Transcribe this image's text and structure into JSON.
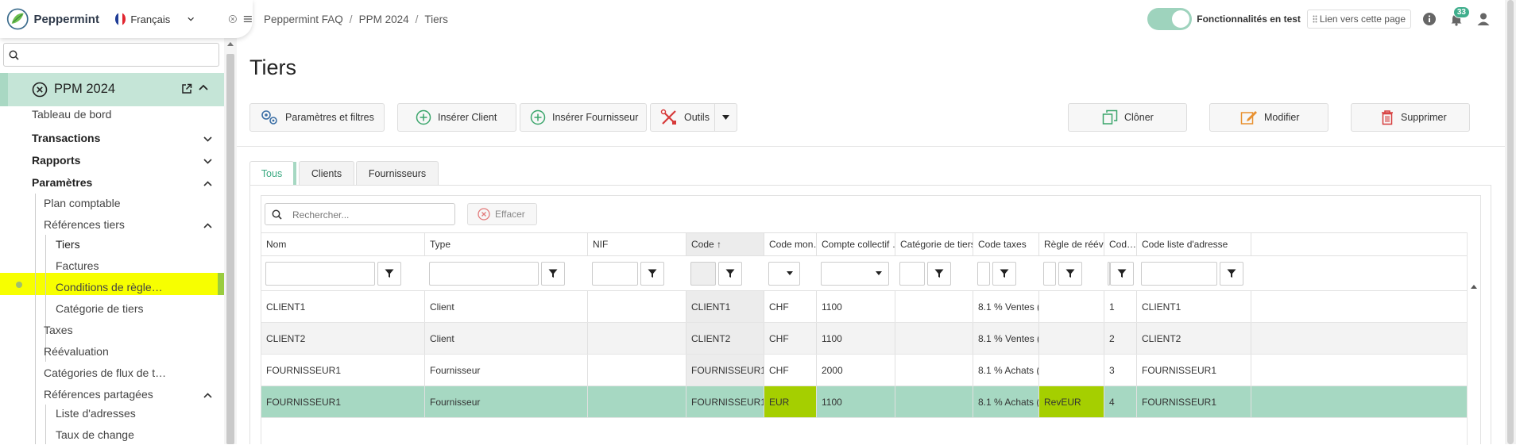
{
  "brand": {
    "app_name": "Peppermint",
    "language": "Français"
  },
  "breadcrumb": [
    "Peppermint FAQ",
    "PPM 2024",
    "Tiers"
  ],
  "header": {
    "toggle_label": "Fonctionnalités en test",
    "link_label": "Lien vers cette page",
    "notification_count": "33"
  },
  "sidebar": {
    "search_value": "",
    "project": "PPM 2024",
    "items": [
      {
        "label": "Tableau de bord"
      },
      {
        "label": "Transactions"
      },
      {
        "label": "Rapports"
      },
      {
        "label": "Paramètres"
      },
      {
        "label": "Plan comptable"
      },
      {
        "label": "Références tiers"
      },
      {
        "label": "Tiers"
      },
      {
        "label": "Factures"
      },
      {
        "label": "Conditions de règle…"
      },
      {
        "label": "Catégorie de tiers"
      },
      {
        "label": "Taxes"
      },
      {
        "label": "Réévaluation"
      },
      {
        "label": "Catégories de flux de t…"
      },
      {
        "label": "Références partagées"
      },
      {
        "label": "Liste d'adresses"
      },
      {
        "label": "Taux de change"
      }
    ]
  },
  "page": {
    "title": "Tiers"
  },
  "toolbar": {
    "params": "Paramètres et filtres",
    "insert_client": "Insérer Client",
    "insert_supplier": "Insérer Fournisseur",
    "tools": "Outils",
    "clone": "Clôner",
    "edit": "Modifier",
    "delete": "Supprimer"
  },
  "tabs": [
    "Tous",
    "Clients",
    "Fournisseurs"
  ],
  "grid": {
    "search_placeholder": "Rechercher...",
    "clear_label": "Effacer",
    "columns": [
      "Nom",
      "Type",
      "NIF",
      "Code",
      "Code mon…",
      "Compte collectif …",
      "Catégorie de tiers",
      "Code taxes",
      "Règle de réév…",
      "Cod…",
      "Code liste d'adresse"
    ],
    "sort_indicator": "↑",
    "rows": [
      [
        "CLIENT1",
        "Client",
        "",
        "CLIENT1",
        "CHF",
        "1100",
        "",
        "8.1 % Ventes (…",
        "",
        "1",
        "CLIENT1"
      ],
      [
        "CLIENT2",
        "Client",
        "",
        "CLIENT2",
        "CHF",
        "1100",
        "",
        "8.1 % Ventes (…",
        "",
        "2",
        "CLIENT2"
      ],
      [
        "FOURNISSEUR1",
        "Fournisseur",
        "",
        "FOURNISSEUR1",
        "CHF",
        "2000",
        "",
        "8.1 % Achats (…",
        "",
        "3",
        "FOURNISSEUR1"
      ],
      [
        "FOURNISSEUR1",
        "Fournisseur",
        "",
        "FOURNISSEUR1",
        "EUR",
        "1100",
        "",
        "8.1 % Achats (…",
        "RevEUR",
        "4",
        "FOURNISSEUR1"
      ]
    ]
  },
  "colors": {
    "accent": "#3aa981",
    "selected_row": "#a6d8c2",
    "highlight_yellow": "#f7ff00",
    "highlight_green": "#a5cf00"
  }
}
